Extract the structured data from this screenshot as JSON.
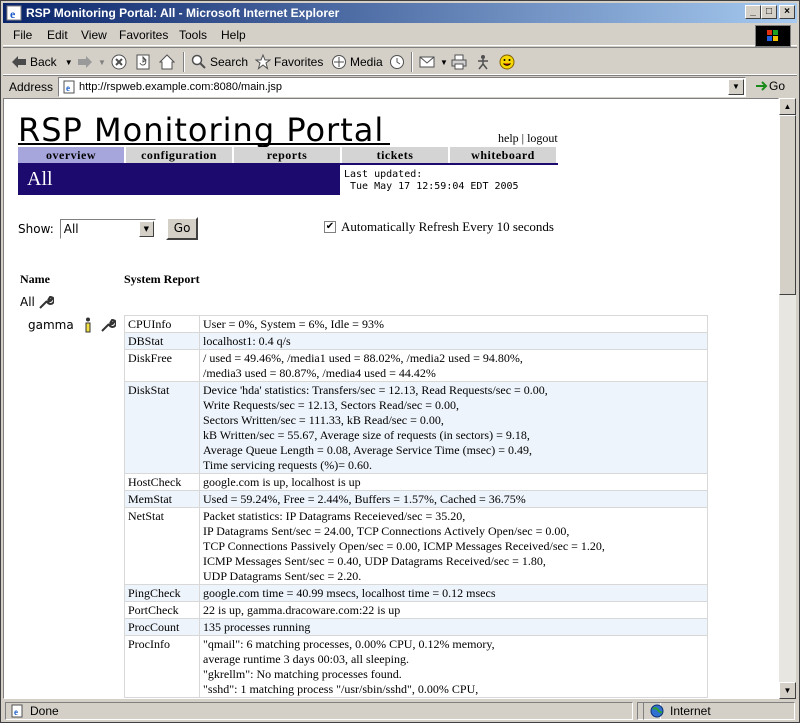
{
  "window": {
    "title": "RSP Monitoring Portal: All - Microsoft Internet Explorer"
  },
  "menu": [
    "File",
    "Edit",
    "View",
    "Favorites",
    "Tools",
    "Help"
  ],
  "toolbar": {
    "back": "Back",
    "search": "Search",
    "favorites": "Favorites",
    "media": "Media"
  },
  "address": {
    "label": "Address",
    "url": "http://rspweb.example.com:8080/main.jsp",
    "go": "Go"
  },
  "status": {
    "text": "Done",
    "zone": "Internet"
  },
  "page": {
    "title": "RSP Monitoring Portal",
    "help": "help",
    "sep": "|",
    "logout": "logout",
    "tabs": [
      "overview",
      "configuration",
      "reports",
      "tickets",
      "whiteboard"
    ],
    "current": "All",
    "last_updated_label": "Last updated:",
    "last_updated": "Tue May 17 12:59:04 EDT 2005",
    "show_label": "Show:",
    "show_value": "All",
    "go_label": "Go",
    "auto_refresh": "Automatically Refresh Every 10 seconds",
    "col_name": "Name",
    "col_report": "System Report",
    "root_node": "All",
    "host_node": "gamma",
    "report": [
      {
        "key": "CPUInfo",
        "lines": [
          "User = 0%, System = 6%, Idle = 93%"
        ]
      },
      {
        "key": "DBStat",
        "lines": [
          "localhost1: 0.4 q/s"
        ]
      },
      {
        "key": "DiskFree",
        "lines": [
          "/ used = 49.46%, /media1 used = 88.02%, /media2 used = 94.80%,",
          "/media3 used = 80.87%, /media4 used = 44.42%"
        ]
      },
      {
        "key": "DiskStat",
        "lines": [
          "Device 'hda' statistics: Transfers/sec = 12.13, Read Requests/sec = 0.00,",
          "Write Requests/sec = 12.13, Sectors Read/sec = 0.00,",
          "Sectors Written/sec = 111.33, kB Read/sec = 0.00,",
          "kB Written/sec = 55.67, Average size of requests (in sectors) = 9.18,",
          "Average Queue Length = 0.08, Average Service Time (msec) = 0.49,",
          "Time servicing requests (%)= 0.60."
        ]
      },
      {
        "key": "HostCheck",
        "lines": [
          "google.com is up, localhost is up"
        ]
      },
      {
        "key": "MemStat",
        "lines": [
          "Used = 59.24%, Free = 2.44%, Buffers = 1.57%, Cached = 36.75%"
        ]
      },
      {
        "key": "NetStat",
        "lines": [
          "Packet statistics: IP Datagrams Receieved/sec = 35.20,",
          "IP Datagrams Sent/sec = 24.00, TCP Connections Actively Open/sec = 0.00,",
          "TCP Connections Passively Open/sec = 0.00, ICMP Messages Received/sec = 1.20,",
          "ICMP Messages Sent/sec = 0.40, UDP Datagrams Received/sec = 1.80,",
          "UDP Datagrams Sent/sec = 2.20."
        ]
      },
      {
        "key": "PingCheck",
        "lines": [
          "google.com time = 40.99 msecs, localhost time = 0.12 msecs"
        ]
      },
      {
        "key": "PortCheck",
        "lines": [
          "22 is up, gamma.dracoware.com:22 is up"
        ]
      },
      {
        "key": "ProcCount",
        "lines": [
          "135 processes running"
        ]
      },
      {
        "key": "ProcInfo",
        "lines": [
          "\"qmail\": 6 matching processes, 0.00% CPU, 0.12% memory,",
          "average runtime 3 days 00:03, all sleeping.",
          "\"gkrellm\": No matching processes found.",
          "\"sshd\": 1 matching process \"/usr/sbin/sshd\", 0.00% CPU,"
        ]
      }
    ]
  },
  "colors": {
    "title_bar": "#0a246a",
    "active_tab": "#a7a6dc",
    "header_bar": "#1c0a6e",
    "row_alt": "#eef4fb"
  }
}
